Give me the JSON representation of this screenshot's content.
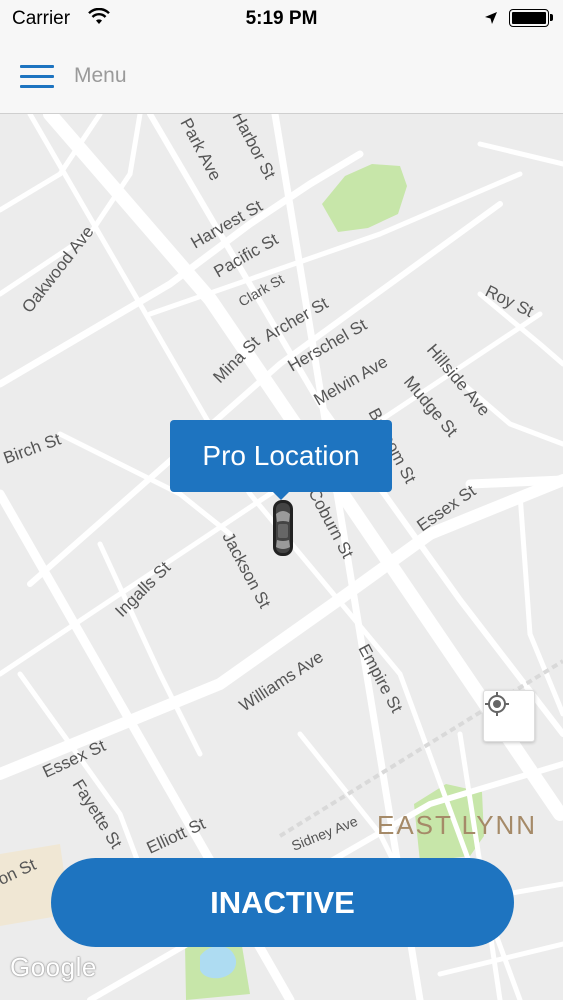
{
  "status_bar": {
    "carrier": "Carrier",
    "time": "5:19 PM"
  },
  "nav": {
    "menu_label": "Menu"
  },
  "map": {
    "callout": "Pro Location",
    "district": "EAST LYNN",
    "attribution": "Google",
    "streets": [
      "Park Ave",
      "Harbor St",
      "Harvest St",
      "Pacific St",
      "Clark St",
      "Archer St",
      "Herschel St",
      "Melvin Ave",
      "Roy St",
      "Hillside Ave",
      "Mudge St",
      "Oakwood Ave",
      "Birch St",
      "Bascom St",
      "Coburn St",
      "Essex St",
      "Ingalls St",
      "Jackson St",
      "Williams Ave",
      "Empire St",
      "Essex St",
      "Fayette St",
      "Sidney Ave",
      "Union St",
      "Elliott St",
      "Mina St"
    ],
    "colors": {
      "water": "#aedcf2",
      "park": "#c7e6a9",
      "road": "#ffffff",
      "land": "#ececec"
    }
  },
  "action": {
    "status_button": "INACTIVE"
  },
  "icons": {
    "menu": "hamburger-icon",
    "car": "car-icon",
    "locate": "crosshair-icon",
    "wifi": "wifi-icon",
    "location_arrow": "location-arrow-icon",
    "battery": "battery-icon"
  }
}
